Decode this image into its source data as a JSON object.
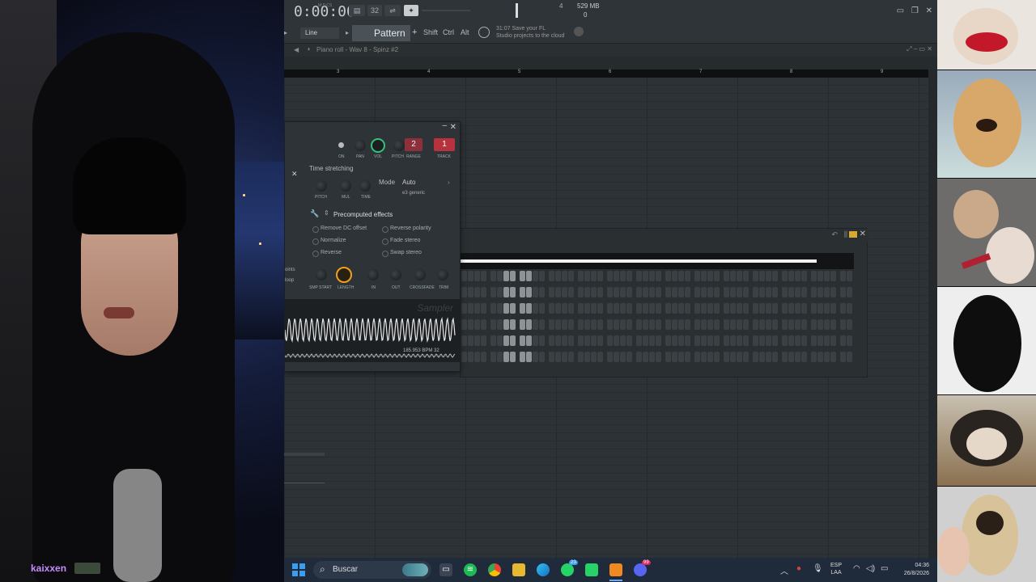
{
  "stream": {
    "streamer_name": "kaixxen"
  },
  "fl": {
    "timecode": "0:00:00",
    "timecode_label": "M:S:CS",
    "cpu_value": "4",
    "memory": "529 MB",
    "voices": "0",
    "snap": "Line",
    "pattern": "Pattern 1",
    "pattern_add": "+",
    "modifiers": [
      "Shift",
      "Ctrl",
      "Alt"
    ],
    "hint_time": "31:07",
    "hint_text": "Save your FL\nStudio projects to the cloud",
    "piano_roll_title": "Piano roll - Wav 8 - Spinz #2",
    "bar_numbers": [
      "3",
      "4",
      "5",
      "6",
      "7",
      "8",
      "9"
    ]
  },
  "sampler": {
    "knob_labels": [
      "ON",
      "PAN",
      "VOL",
      "PITCH",
      "RANGE",
      "TRACK"
    ],
    "pitch_range": "2",
    "track": "1",
    "time_stretching": "Time stretching",
    "ts_knobs": [
      "PITCH",
      "MUL",
      "TIME"
    ],
    "mode_label": "Mode",
    "mode_value": "Auto",
    "mode_sub": "e3 generic",
    "precomputed": "Precomputed effects",
    "options_left": [
      "Remove DC offset",
      "Normalize",
      "Reverse"
    ],
    "options_right": [
      "Reverse polarity",
      "Fade stereo",
      "Swap stereo"
    ],
    "bottom_knobs": [
      "SMP START",
      "LENGTH",
      "IN",
      "OUT",
      "CROSSFADE",
      "TRIM"
    ],
    "side_labels": [
      "oints",
      "loop"
    ],
    "watermark": "Sampler",
    "bpm": "185.953 BPM 32"
  },
  "rack": {
    "rows": 6
  },
  "taskbar": {
    "search_placeholder": "Buscar",
    "badge_whatsapp": "23",
    "badge_discord": "99",
    "lang_top": "ESP",
    "lang_bottom": "LAA",
    "time": "04:36",
    "date": "26/8/2026"
  },
  "colors": {
    "accent_red": "#b8323e",
    "knob_green": "#34c27a",
    "knob_orange": "#f0a020",
    "streamer_name": "#c58cff"
  }
}
